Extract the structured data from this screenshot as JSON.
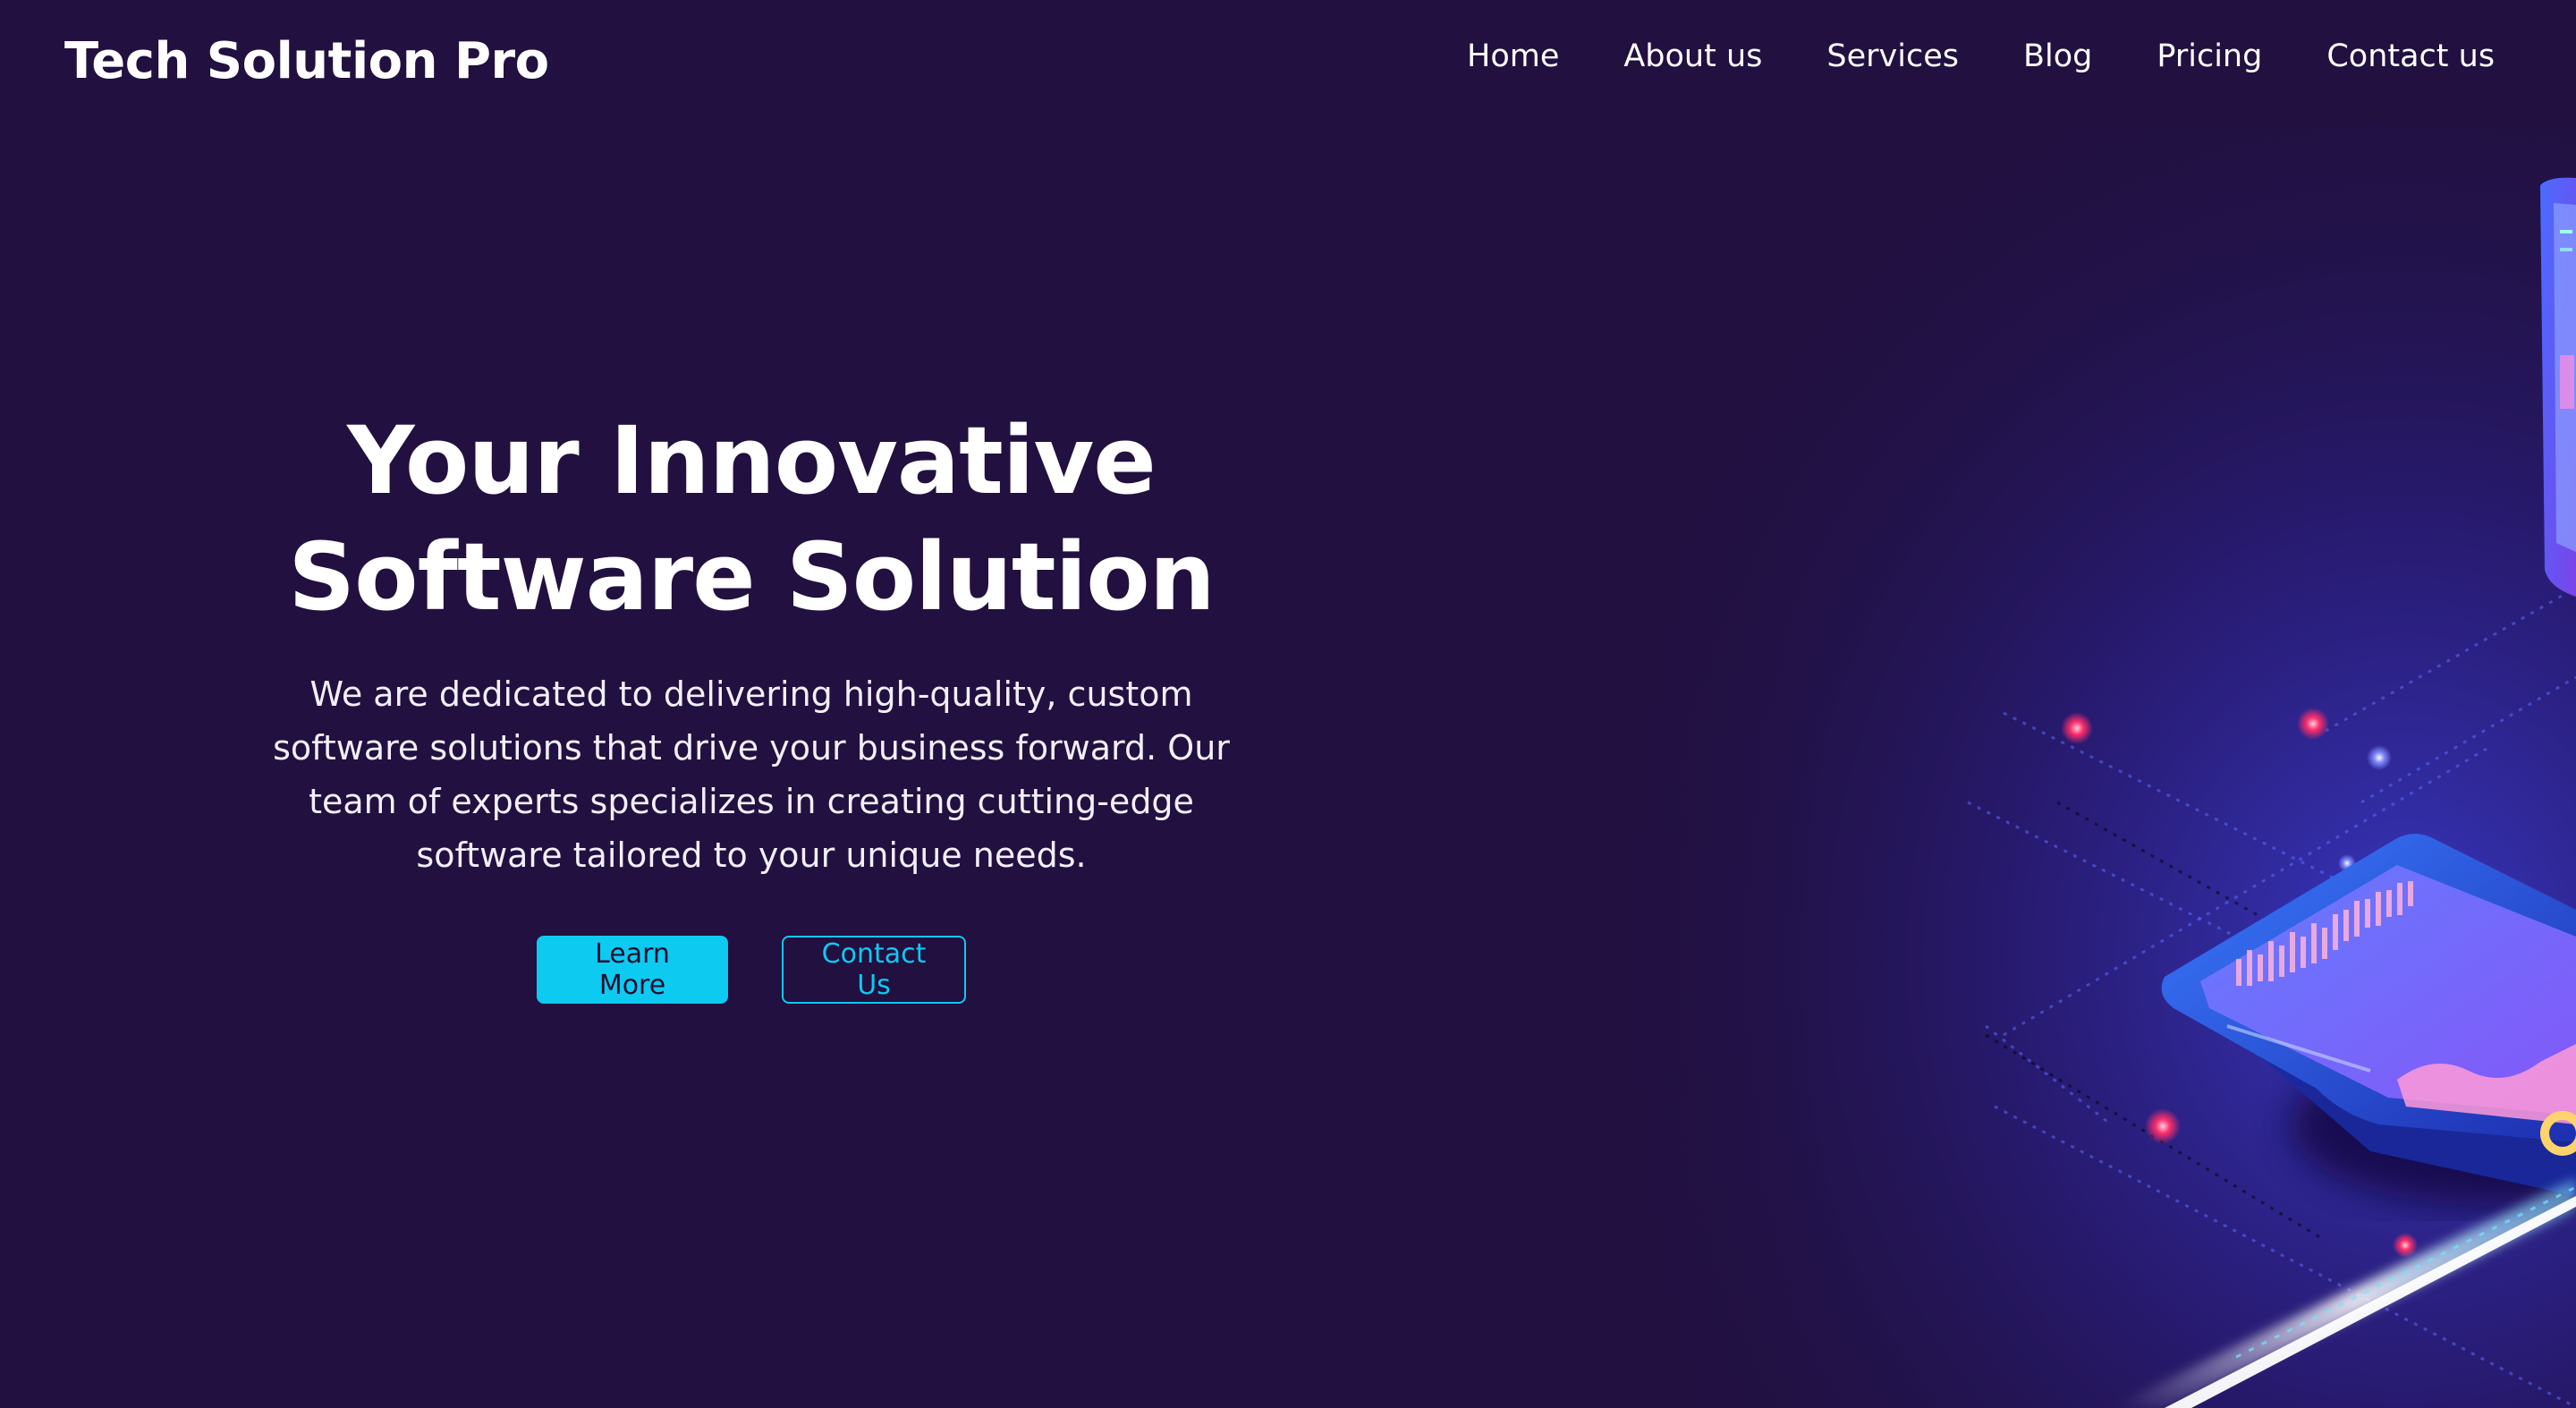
{
  "brand": {
    "name": "Tech Solution Pro"
  },
  "nav": {
    "items": [
      {
        "label": "Home"
      },
      {
        "label": "About us"
      },
      {
        "label": "Services"
      },
      {
        "label": "Blog"
      },
      {
        "label": "Pricing"
      },
      {
        "label": "Contact us"
      }
    ]
  },
  "hero": {
    "title_line1": "Your Innovative",
    "title_line2": "Software Solution",
    "description": "We are dedicated to delivering high-quality, custom software solutions that drive your business forward. Our team of experts specializes in creating cutting-edge software tailored to your unique needs.",
    "primary_button": "Learn More",
    "secondary_button": "Contact Us"
  },
  "colors": {
    "background": "#211040",
    "accent": "#0dcaf0",
    "text": "#ffffff"
  },
  "illustration": {
    "icon": "isometric-devices-illustration"
  }
}
